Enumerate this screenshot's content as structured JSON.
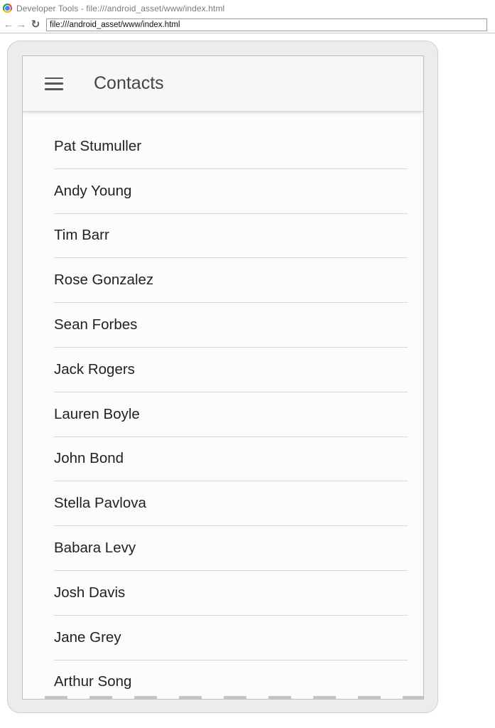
{
  "browser": {
    "window_title": "Developer Tools - file:///android_asset/www/index.html",
    "url": "file:///android_asset/www/index.html",
    "icons": {
      "back": "arrow-left-icon",
      "forward": "arrow-right-icon",
      "reload": "reload-icon"
    }
  },
  "app": {
    "title": "Contacts",
    "menu_icon": "hamburger-menu-icon",
    "contacts": [
      "Pat Stumuller",
      "Andy Young",
      "Tim Barr",
      "Rose Gonzalez",
      "Sean Forbes",
      "Jack Rogers",
      "Lauren Boyle",
      "John Bond",
      "Stella Pavlova",
      "Babara Levy",
      "Josh Davis",
      "Jane Grey",
      "Arthur Song"
    ]
  },
  "colors": {
    "appbar_background": "#f8f6f9",
    "list_background": "#fdfcfd",
    "divider": "#d8d8d8",
    "text": "#222222"
  }
}
